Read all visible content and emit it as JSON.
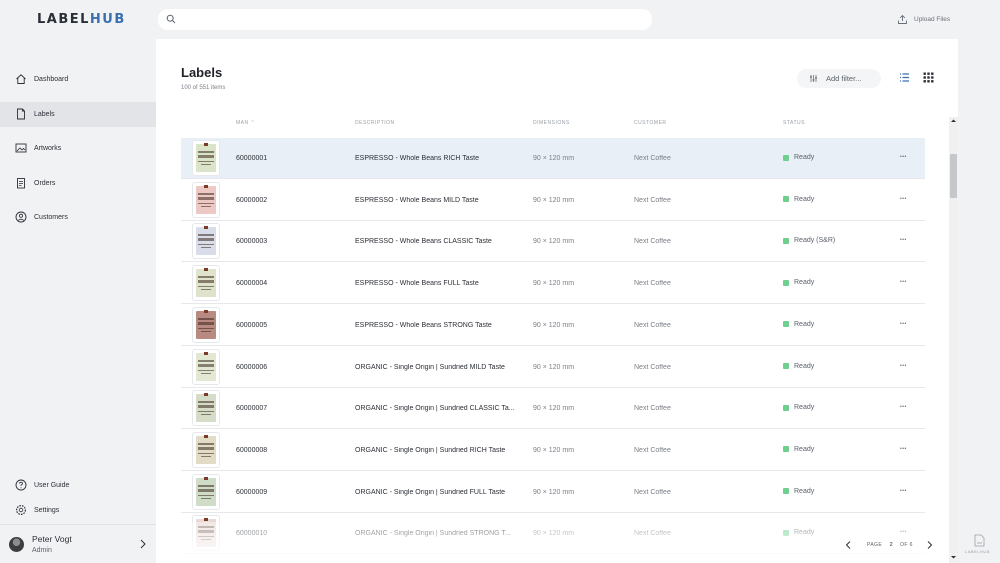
{
  "app": {
    "logo_main": "LABEL",
    "logo_accent": "HUB"
  },
  "sidebar": {
    "items": [
      {
        "label": "Dashboard",
        "icon": "home-icon",
        "active": false
      },
      {
        "label": "Labels",
        "icon": "document-icon",
        "active": true
      },
      {
        "label": "Artworks",
        "icon": "image-icon",
        "active": false
      },
      {
        "label": "Orders",
        "icon": "clipboard-icon",
        "active": false
      },
      {
        "label": "Customers",
        "icon": "user-circle-icon",
        "active": false
      }
    ],
    "bottom_items": [
      {
        "label": "User Guide",
        "icon": "help-icon"
      },
      {
        "label": "Settings",
        "icon": "gear-icon"
      }
    ],
    "user": {
      "name": "Peter Vogt",
      "role": "Admin"
    }
  },
  "search": {
    "placeholder": ""
  },
  "header": {
    "upload_label": "Upload Files"
  },
  "page": {
    "title": "Labels",
    "count_text": "100 of 551 items",
    "filter_label": "Add filter..."
  },
  "table": {
    "columns": {
      "man": "MAN",
      "description": "DESCRIPTION",
      "dimensions": "DIMENSIONS",
      "customer": "CUSTOMER",
      "status": "STATUS"
    },
    "rows": [
      {
        "man": "60000001",
        "description": "ESPRESSO - Whole Beans RICH Taste",
        "dimensions": "90 × 120 mm",
        "customer": "Next Coffee",
        "status": "Ready",
        "color": "#d9e4c8"
      },
      {
        "man": "60000002",
        "description": "ESPRESSO - Whole Beans MILD Taste",
        "dimensions": "90 × 120 mm",
        "customer": "Next Coffee",
        "status": "Ready",
        "color": "#ecc9c4"
      },
      {
        "man": "60000003",
        "description": "ESPRESSO - Whole Beans CLASSIC Taste",
        "dimensions": "90 × 120 mm",
        "customer": "Next Coffee",
        "status": "Ready (S&R)",
        "color": "#d9dde9"
      },
      {
        "man": "60000004",
        "description": "ESPRESSO - Whole Beans FULL Taste",
        "dimensions": "90 × 120 mm",
        "customer": "Next Coffee",
        "status": "Ready",
        "color": "#dfe3cc"
      },
      {
        "man": "60000005",
        "description": "ESPRESSO - Whole Beans STRONG Taste",
        "dimensions": "90 × 120 mm",
        "customer": "Next Coffee",
        "status": "Ready",
        "color": "#b98a82"
      },
      {
        "man": "60000006",
        "description": "ORGANIC - Single Origin | Sundried MILD Taste",
        "dimensions": "90 × 120 mm",
        "customer": "Next Coffee",
        "status": "Ready",
        "color": "#e3e8d2"
      },
      {
        "man": "60000007",
        "description": "ORGANIC - Single Origin | Sundried CLASSIC Ta...",
        "dimensions": "90 × 120 mm",
        "customer": "Next Coffee",
        "status": "Ready",
        "color": "#d5ddc9"
      },
      {
        "man": "60000008",
        "description": "ORGANIC - Single Origin | Sundried RICH Taste",
        "dimensions": "90 × 120 mm",
        "customer": "Next Coffee",
        "status": "Ready",
        "color": "#e2dcc6"
      },
      {
        "man": "60000009",
        "description": "ORGANIC - Single Origin | Sundried FULL Taste",
        "dimensions": "90 × 120 mm",
        "customer": "Next Coffee",
        "status": "Ready",
        "color": "#cfdcc7"
      },
      {
        "man": "60000010",
        "description": "ORGANIC - Single Origin | Sundried STRONG T...",
        "dimensions": "90 × 120 mm",
        "customer": "Next Coffee",
        "status": "Ready",
        "color": "#e8d9d4"
      }
    ]
  },
  "pagination": {
    "page_label": "PAGE",
    "page": "2",
    "of_label": "OF 6"
  },
  "corner_logo": {
    "text": "LABELHUB"
  },
  "colors": {
    "accent": "#3a6fb0",
    "status_ready": "#6fcf8f",
    "selected_row": "#e9eff6"
  }
}
